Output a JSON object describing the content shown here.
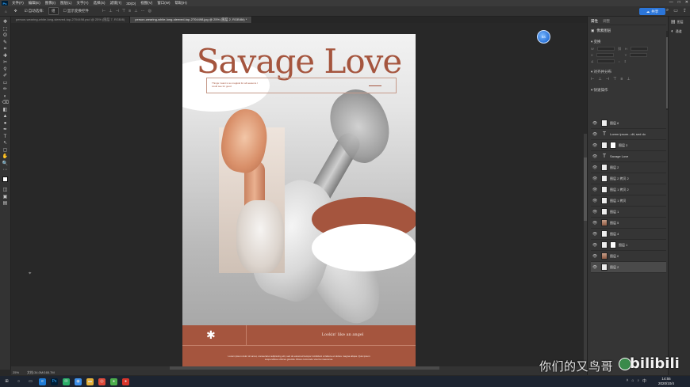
{
  "menubar": {
    "logo": "Ps",
    "items": [
      "文件(F)",
      "编辑(E)",
      "图像(I)",
      "图层(L)",
      "文字(Y)",
      "选择(S)",
      "滤镜(T)",
      "3D(D)",
      "视图(V)",
      "窗口(W)",
      "帮助(H)"
    ],
    "window_controls": [
      "—",
      "□",
      "✕"
    ]
  },
  "options": {
    "auto_select_label": "自动选择:",
    "auto_select_value": "组",
    "transform_label": "显示变换控件",
    "share_label": "共享"
  },
  "tabs": [
    {
      "label": "person-wearing-white-long-sleeved-top-2704498.psd @ 25% (图层 7, RGB/8)",
      "active": false
    },
    {
      "label": "person-wearing-white-long-sleeved-top-2704498.jpg @ 25% (图层 2, RGB/8#) *",
      "active": true
    }
  ],
  "tools": [
    "✥",
    "⬚",
    "ʘ",
    "✎",
    "⌗",
    "✚",
    "✂",
    "⚲",
    "✐",
    "▭",
    "✏",
    "◐",
    "⌫",
    "◧",
    "▲",
    "●",
    "✒",
    "T",
    "↖",
    "▢",
    "✋",
    "🔍",
    "⋯",
    "◫",
    "▣",
    "▤"
  ],
  "poster": {
    "title": "Savage Love",
    "subtitle_text": "Things I want is so magical for all seasons I could see for good",
    "footer_star": "✱",
    "footer_tagline": "Lookin' like an angel",
    "footer_body": "Lorem ipsum dolor sit amet, consectetur adipiscing elit, sed do eiusmod tempor incididunt ut labore et dolore magna aliqua. Quis ipsum suspendisse ultrices gravida. Risus commodo viverra maecenas."
  },
  "floating_badge": "BS",
  "status": {
    "zoom": "25%",
    "doc_size": "文档:34.0M/165.7M"
  },
  "properties": {
    "tabs": [
      "属性",
      "调整"
    ],
    "header": "像素图层",
    "transform_label": "变换",
    "w_label": "W",
    "h_label": "H",
    "x_label": "X",
    "y_label": "Y",
    "align_label": "对齐并分布",
    "quick_label": "快速操作"
  },
  "side_panels": [
    {
      "icon": "▤",
      "label": "图层"
    },
    {
      "icon": "◐",
      "label": "通道"
    }
  ],
  "layers": [
    {
      "name": "图层 6",
      "thumb": "img",
      "selected": false
    },
    {
      "name": "Lorem ipsum...dit, sed do",
      "thumb": "text",
      "selected": false
    },
    {
      "name": "图层 3",
      "thumb": "img-mask",
      "selected": false
    },
    {
      "name": "Savage Love",
      "thumb": "text",
      "selected": false
    },
    {
      "name": "图层 2",
      "thumb": "img",
      "selected": false
    },
    {
      "name": "图层 2 拷贝 2",
      "thumb": "img",
      "selected": false
    },
    {
      "name": "图层 1 拷贝 2",
      "thumb": "img",
      "selected": false
    },
    {
      "name": "图层 1 拷贝",
      "thumb": "img",
      "selected": false
    },
    {
      "name": "图层 1",
      "thumb": "img",
      "selected": false
    },
    {
      "name": "图层 5",
      "thumb": "photo",
      "selected": false
    },
    {
      "name": "图层 4",
      "thumb": "img",
      "selected": false
    },
    {
      "name": "图层 1",
      "thumb": "img-mask",
      "selected": false
    },
    {
      "name": "图层 0",
      "thumb": "photo",
      "selected": false
    },
    {
      "name": "图层 2",
      "thumb": "img",
      "selected": true
    }
  ],
  "watermark": {
    "text": "你们的又鸟哥",
    "brand": "bilibili"
  },
  "taskbar": {
    "time": "14:55",
    "date": "2020/10/4"
  },
  "colors": {
    "poster_accent": "#a5553e",
    "share_button": "#2c76d9"
  }
}
